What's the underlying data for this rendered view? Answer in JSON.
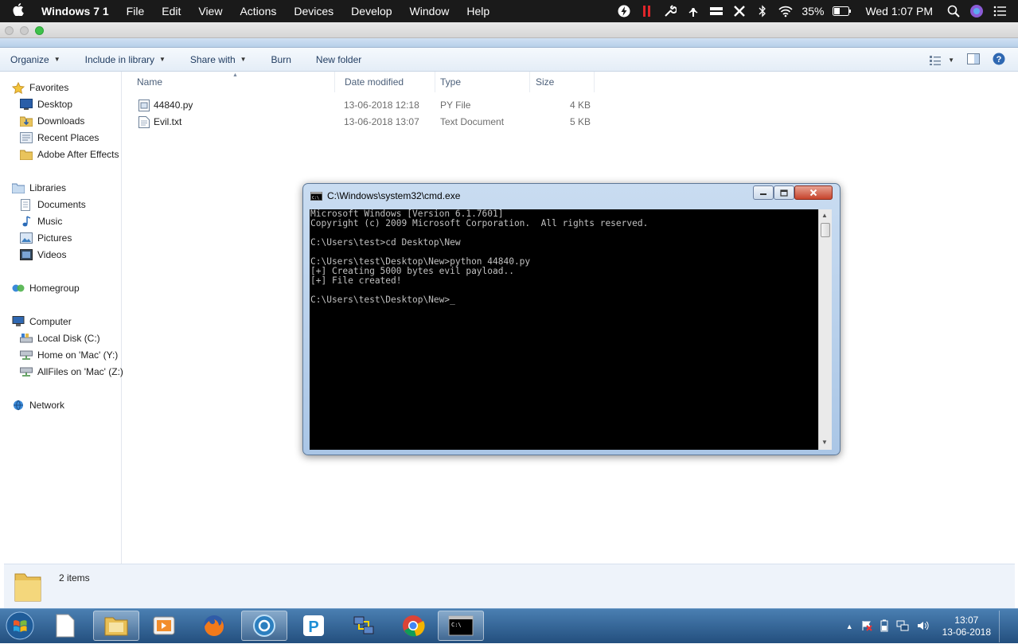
{
  "menubar": {
    "app_name": "Windows 7 1",
    "menus": [
      "File",
      "Edit",
      "View",
      "Actions",
      "Devices",
      "Develop",
      "Window",
      "Help"
    ],
    "battery": "35%",
    "clock": "Wed 1:07 PM"
  },
  "toolbar": {
    "organize": "Organize",
    "include_in_library": "Include in library",
    "share_with": "Share with",
    "burn": "Burn",
    "new_folder": "New folder"
  },
  "nav": {
    "favorites": "Favorites",
    "desktop": "Desktop",
    "downloads": "Downloads",
    "recent_places": "Recent Places",
    "adobe_after_effects": "Adobe After Effects",
    "libraries": "Libraries",
    "documents": "Documents",
    "music": "Music",
    "pictures": "Pictures",
    "videos": "Videos",
    "homegroup": "Homegroup",
    "computer": "Computer",
    "local_disk": "Local Disk (C:)",
    "home_on_mac": "Home on 'Mac' (Y:)",
    "allfiles_on_mac": "AllFiles on 'Mac' (Z:)",
    "network": "Network"
  },
  "columns": {
    "name": "Name",
    "date_modified": "Date modified",
    "type": "Type",
    "size": "Size"
  },
  "files": [
    {
      "name": "44840.py",
      "date": "13-06-2018 12:18",
      "type": "PY File",
      "size": "4 KB"
    },
    {
      "name": "Evil.txt",
      "date": "13-06-2018 13:07",
      "type": "Text Document",
      "size": "5 KB"
    }
  ],
  "details": {
    "item_count": "2 items"
  },
  "cmd": {
    "title": "C:\\Windows\\system32\\cmd.exe",
    "lines": [
      "Microsoft Windows [Version 6.1.7601]",
      "Copyright (c) 2009 Microsoft Corporation.  All rights reserved.",
      "",
      "C:\\Users\\test>cd Desktop\\New",
      "",
      "C:\\Users\\test\\Desktop\\New>python 44840.py",
      "[+] Creating 5000 bytes evil payload..",
      "[+] File created!",
      "",
      "C:\\Users\\test\\Desktop\\New>_"
    ]
  },
  "taskbar": {
    "time": "13:07",
    "date": "13-06-2018"
  },
  "colors": {
    "menubar_bg": "#1a1a1a",
    "taskbar_bg": "#2f5f90",
    "console_bg": "#000000",
    "console_fg": "#c0c0c0",
    "link_blue": "#1e3a5f"
  }
}
